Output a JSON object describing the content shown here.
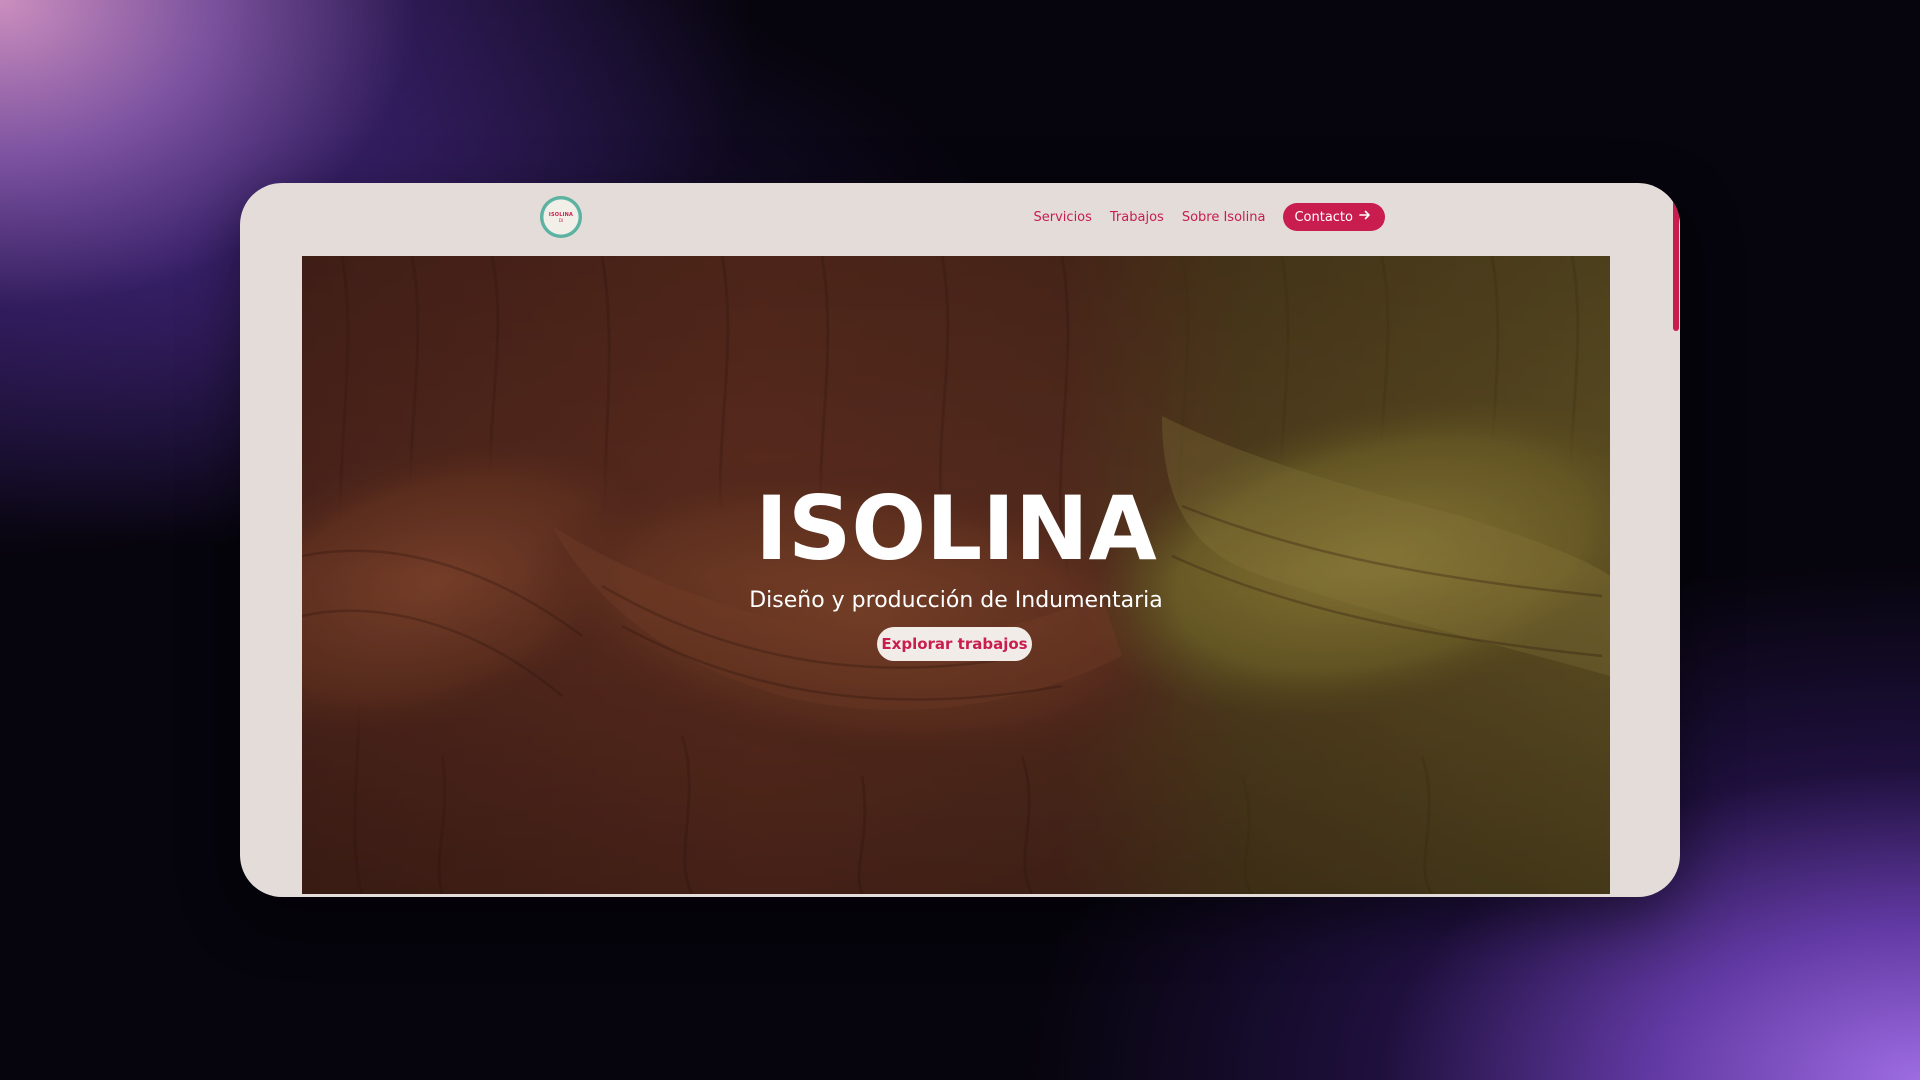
{
  "site": {
    "logo": {
      "text": "ISOLINA",
      "subtext": "DI"
    }
  },
  "nav": {
    "links": [
      "Servicios",
      "Trabajos",
      "Sobre Isolina"
    ],
    "contact_label": "Contacto"
  },
  "hero": {
    "title": "ISOLINA",
    "subtitle": "Diseño y producción de Indumentaria",
    "cta_label": "Explorar trabajos"
  },
  "colors": {
    "accent": "#c81d4e",
    "page_background": "#e3dcd8",
    "logo_ring": "#3e9b89"
  },
  "icons": {
    "contact": "arrow-right-icon"
  }
}
